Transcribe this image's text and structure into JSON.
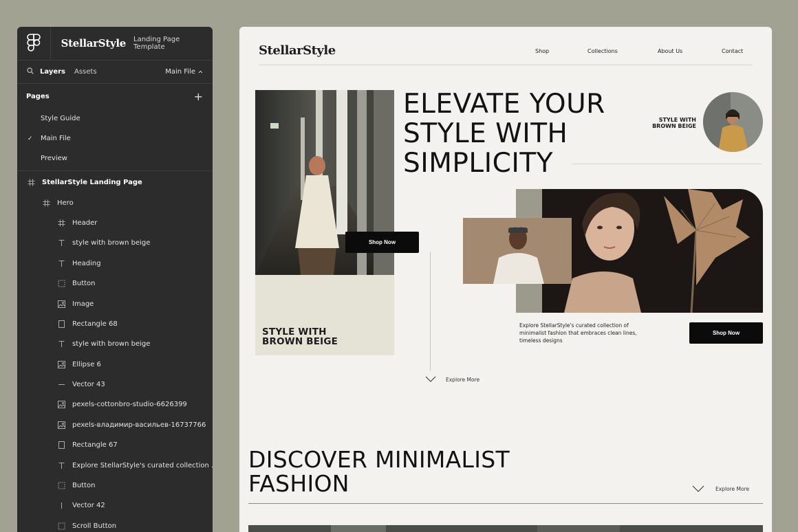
{
  "panel": {
    "brand": "StellarStyle",
    "subtitle": "Landing Page Template",
    "tabs": {
      "layers": "Layers",
      "assets": "Assets",
      "file": "Main File"
    },
    "pages_label": "Pages",
    "pages": [
      {
        "label": "Style Guide",
        "selected": false
      },
      {
        "label": "Main File",
        "selected": true
      },
      {
        "label": "Preview",
        "selected": false
      }
    ],
    "layers": [
      {
        "label": "StellarStyle Landing Page",
        "icon": "frame-icon"
      },
      {
        "label": "Hero",
        "icon": "frame-icon"
      },
      {
        "label": "Header",
        "icon": "frame-icon"
      },
      {
        "label": "style with brown beige",
        "icon": "text-icon"
      },
      {
        "label": "Heading",
        "icon": "text-icon"
      },
      {
        "label": "Button",
        "icon": "component-icon"
      },
      {
        "label": "Image",
        "icon": "image-icon"
      },
      {
        "label": "Rectangle 68",
        "icon": "rectangle-icon"
      },
      {
        "label": "style with brown beige",
        "icon": "text-icon"
      },
      {
        "label": "Ellipse 6",
        "icon": "image-icon"
      },
      {
        "label": "Vector 43",
        "icon": "line-icon"
      },
      {
        "label": "pexels-cottonbro-studio-6626399",
        "icon": "image-icon"
      },
      {
        "label": "pexels-владимир-васильев-16737766",
        "icon": "image-icon"
      },
      {
        "label": "Rectangle 67",
        "icon": "rectangle-icon"
      },
      {
        "label": "Explore StellarStyle's curated collection ...",
        "icon": "text-icon"
      },
      {
        "label": "Button",
        "icon": "component-icon"
      },
      {
        "label": "Vector 42",
        "icon": "vline-icon"
      },
      {
        "label": "Scroll Button",
        "icon": "component-icon"
      }
    ]
  },
  "site": {
    "logo": "StellarStyle",
    "nav": [
      "Shop",
      "Collections",
      "About Us",
      "Contact"
    ],
    "hero_heading": [
      "ELEVATE YOUR",
      "STYLE WITH",
      "SIMPLICITY"
    ],
    "beige_text": [
      "STYLE WITH",
      "BROWN BEIGE"
    ],
    "circle_text": [
      "STYLE WITH",
      "BROWN BEIGE"
    ],
    "shop_now": "Shop Now",
    "description": "Explore StellarStyle's curated collection of minimalist fashion that embraces clean lines, timeless designs",
    "explore_more": "Explore More",
    "discover_heading": [
      "DISCOVER MINIMALIST",
      "FASHION"
    ]
  },
  "colors": {
    "background": "#a2a292",
    "panel": "#2c2c2c",
    "page": "#f3f2ee",
    "beige": "#e5e2d6",
    "button": "#0b0b0b"
  }
}
